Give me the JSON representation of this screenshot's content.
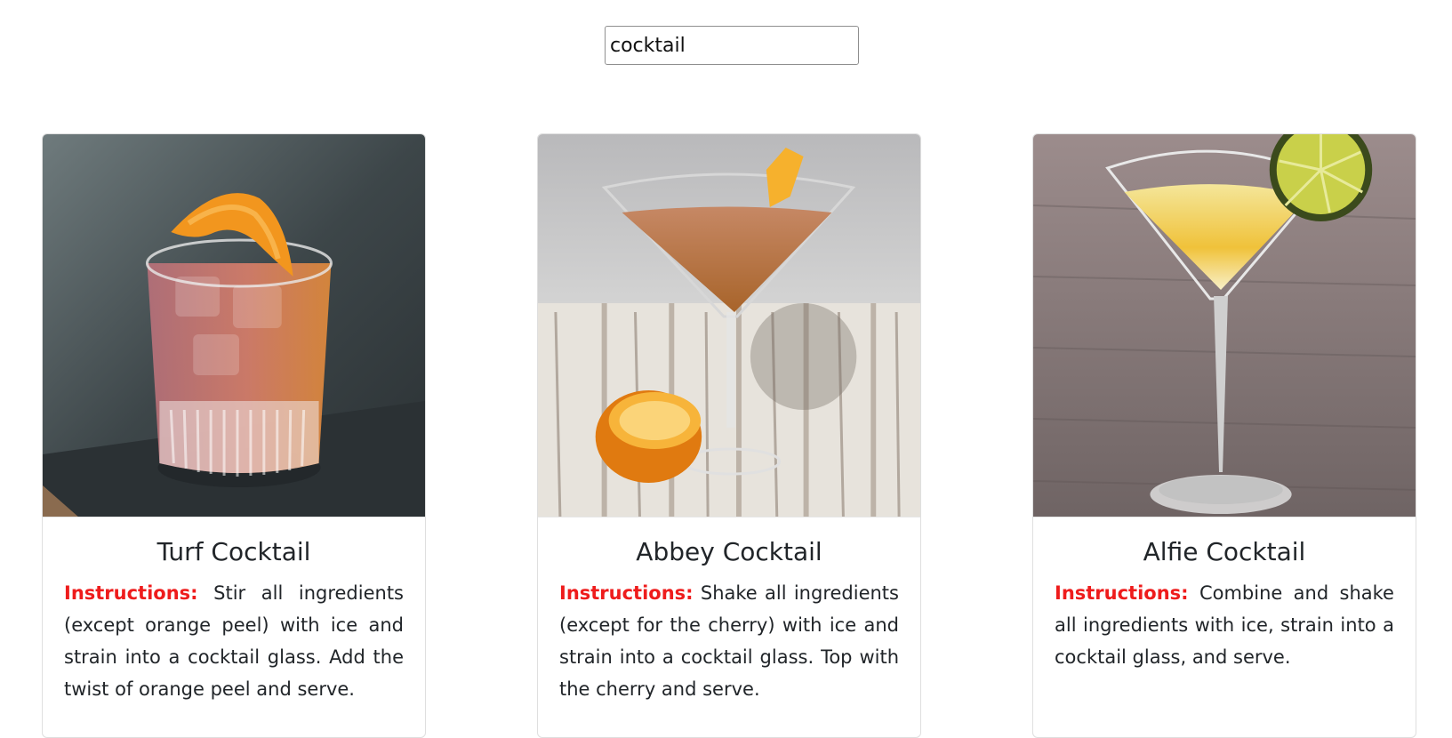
{
  "search": {
    "value": "cocktail"
  },
  "cards": [
    {
      "title": "Turf Cocktail",
      "label": "Instructions:",
      "text": "Stir all ingredients (except orange peel) with ice and strain into a cocktail glass. Add the twist of orange peel and serve."
    },
    {
      "title": "Abbey Cocktail",
      "label": "Instructions:",
      "text": "Shake all ingredients (except for the cherry) with ice and strain into a cocktail glass. Top with the cherry and serve."
    },
    {
      "title": "Alfie Cocktail",
      "label": "Instructions:",
      "text": "Combine and shake all ingredients with ice, strain into a cocktail glass, and serve."
    }
  ],
  "colors": {
    "instruction_label": "#ee1c1c",
    "title_text": "#212529",
    "card_border": "#dfdfdf"
  }
}
